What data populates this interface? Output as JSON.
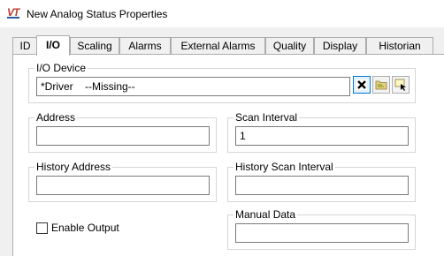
{
  "window": {
    "title": "New Analog Status Properties",
    "icon_text": "VT"
  },
  "tabs": [
    {
      "label": "ID",
      "active": false
    },
    {
      "label": "I/O",
      "active": true
    },
    {
      "label": "Scaling",
      "active": false
    },
    {
      "label": "Alarms",
      "active": false
    },
    {
      "label": "External Alarms",
      "active": false
    },
    {
      "label": "Quality",
      "active": false
    },
    {
      "label": "Display",
      "active": false
    },
    {
      "label": "Historian",
      "active": false
    }
  ],
  "io_device": {
    "label": "I/O Device",
    "value": "*Driver    --Missing--",
    "buttons": [
      "clear-icon",
      "browse-folder-icon",
      "select-pointer-icon"
    ]
  },
  "address": {
    "label": "Address",
    "value": ""
  },
  "scan_interval": {
    "label": "Scan Interval",
    "value": "1"
  },
  "history_address": {
    "label": "History Address",
    "value": ""
  },
  "history_scan_interval": {
    "label": "History Scan Interval",
    "value": ""
  },
  "enable_output": {
    "label": "Enable Output",
    "checked": false
  },
  "manual_data": {
    "label": "Manual Data",
    "value": ""
  }
}
